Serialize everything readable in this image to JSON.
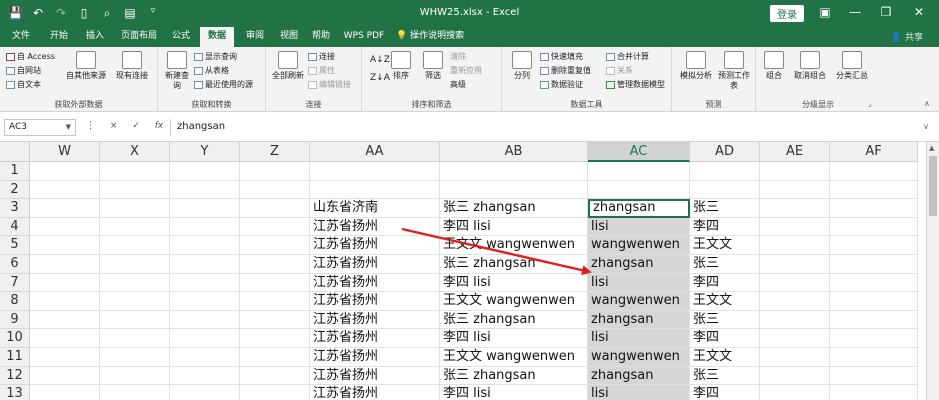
{
  "window": {
    "title": "WHW25.xlsx - Excel",
    "login_label": "登录",
    "quick_access": [
      "save",
      "undo",
      "redo",
      "new",
      "print-preview",
      "format",
      "customize"
    ]
  },
  "tabs": {
    "items": [
      "文件",
      "开始",
      "插入",
      "页面布局",
      "公式",
      "数据",
      "审阅",
      "视图",
      "帮助",
      "WPS PDF",
      "操作说明搜索"
    ],
    "active": "数据",
    "share": "共享"
  },
  "ribbon": {
    "get_external": {
      "label": "获取外部数据",
      "access": "自 Access",
      "web": "自网站",
      "text": "自文本",
      "other": "自其他来源",
      "existing": "现有连接"
    },
    "get_transform": {
      "label": "获取和转换",
      "new_query": "新建查询",
      "show_query": "显示查询",
      "from_table": "从表格",
      "recent": "最近使用的源"
    },
    "connections": {
      "label": "连接",
      "refresh_all": "全部刷新",
      "connections": "连接",
      "properties": "属性",
      "edit_links": "编辑链接"
    },
    "sort_filter": {
      "label": "排序和筛选",
      "sort": "排序",
      "filter": "筛选",
      "clear": "清除",
      "reapply": "重新应用",
      "advanced": "高级"
    },
    "data_tools": {
      "label": "数据工具",
      "split": "分列",
      "flash_fill": "快速填充",
      "remove_dup": "删除重复值",
      "validation": "数据验证",
      "consolidate": "合并计算",
      "relationships": "关系",
      "manage_model": "管理数据模型"
    },
    "forecast": {
      "label": "预测",
      "what_if": "模拟分析",
      "forecast_sheet": "预测工作表"
    },
    "outline": {
      "label": "分级显示",
      "group": "组合",
      "ungroup": "取消组合",
      "subtotal": "分类汇总"
    }
  },
  "formula_bar": {
    "name_box": "AC3",
    "cancel": "×",
    "enter": "✓",
    "fx": "fx",
    "value": "zhangsan"
  },
  "sheet": {
    "columns": [
      "W",
      "X",
      "Y",
      "Z",
      "AA",
      "AB",
      "AC",
      "AD",
      "AE",
      "AF"
    ],
    "selected_column": "AC",
    "active_cell": "AC3",
    "rows": [
      {
        "num": "1",
        "AA": "",
        "AB": "",
        "AC": "",
        "AD": ""
      },
      {
        "num": "2",
        "AA": "",
        "AB": "",
        "AC": "",
        "AD": ""
      },
      {
        "num": "3",
        "AA": "山东省济南",
        "AB": "张三 zhangsan",
        "AC": "zhangsan",
        "AD": "张三"
      },
      {
        "num": "4",
        "AA": "江苏省扬州",
        "AB": "李四 lisi",
        "AC": "lisi",
        "AD": "李四"
      },
      {
        "num": "5",
        "AA": "江苏省扬州",
        "AB": "王文文 wangwenwen",
        "AC": "wangwenwen",
        "AD": "王文文"
      },
      {
        "num": "6",
        "AA": "江苏省扬州",
        "AB": "张三 zhangsan",
        "AC": "zhangsan",
        "AD": "张三"
      },
      {
        "num": "7",
        "AA": "江苏省扬州",
        "AB": "李四 lisi",
        "AC": "lisi",
        "AD": "李四"
      },
      {
        "num": "8",
        "AA": "江苏省扬州",
        "AB": "王文文 wangwenwen",
        "AC": "wangwenwen",
        "AD": "王文文"
      },
      {
        "num": "9",
        "AA": "江苏省扬州",
        "AB": "张三 zhangsan",
        "AC": "zhangsan",
        "AD": "张三"
      },
      {
        "num": "10",
        "AA": "江苏省扬州",
        "AB": "李四 lisi",
        "AC": "lisi",
        "AD": "李四"
      },
      {
        "num": "11",
        "AA": "江苏省扬州",
        "AB": "王文文 wangwenwen",
        "AC": "wangwenwen",
        "AD": "王文文"
      },
      {
        "num": "12",
        "AA": "江苏省扬州",
        "AB": "张三 zhangsan",
        "AC": "zhangsan",
        "AD": "张三"
      },
      {
        "num": "13",
        "AA": "江苏省扬州",
        "AB": "李四 lisi",
        "AC": "lisi",
        "AD": "李四"
      }
    ]
  },
  "colors": {
    "excel_green": "#217346",
    "annotation_arrow": "#e02020",
    "selection_fill": "#d6d6d6"
  }
}
